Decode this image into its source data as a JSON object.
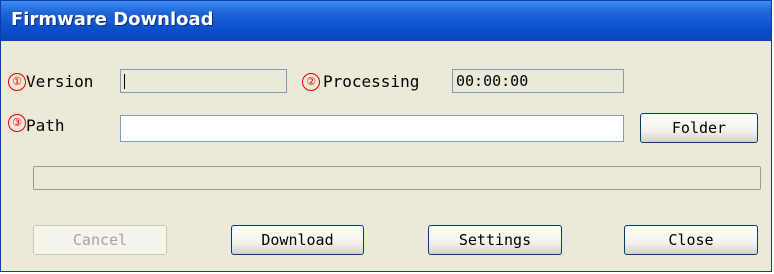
{
  "window": {
    "title": "Firmware Download"
  },
  "markers": {
    "one": "①",
    "two": "②",
    "three": "③"
  },
  "fields": {
    "version_label": "Version",
    "version_value": "",
    "processing_label": "Processing",
    "processing_value": "00:00:00",
    "path_label": "Path",
    "path_value": ""
  },
  "buttons": {
    "folder": "Folder",
    "cancel": "Cancel",
    "download": "Download",
    "settings": "Settings",
    "close": "Close"
  },
  "progress": {
    "value": 0
  },
  "colors": {
    "title_bar": "#0b4fcc",
    "marker": "#e00000",
    "window_bg": "#ece9d8"
  }
}
